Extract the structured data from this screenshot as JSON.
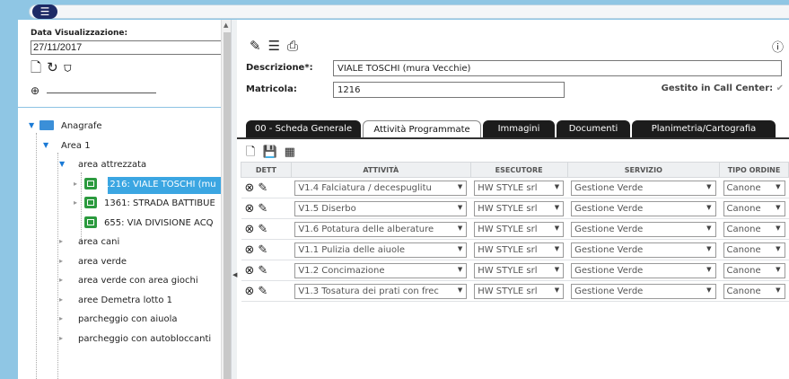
{
  "header": {
    "menu_icon": "hamburger-icon"
  },
  "filters": {
    "date_label": "Data Visualizzazione:",
    "date_value": "27/11/2017"
  },
  "tree": [
    {
      "label": "Anagrafe"
    },
    {
      "label": "Area 1"
    },
    {
      "label": "area attrezzata"
    },
    {
      "label": "1216: VIALE TOSCHI (mu"
    },
    {
      "label": "1361: STRADA BATTIBUE"
    },
    {
      "label": "655: VIA DIVISIONE ACQ"
    },
    {
      "label": "area cani"
    },
    {
      "label": "area verde"
    },
    {
      "label": "area verde con area giochi"
    },
    {
      "label": "aree Demetra lotto 1"
    },
    {
      "label": "parcheggio con aiuola"
    },
    {
      "label": "parcheggio con autobloccanti"
    }
  ],
  "detail": {
    "descrizione_label": "Descrizione*:",
    "descrizione_value": "VIALE TOSCHI (mura Vecchie)",
    "matricola_label": "Matricola:",
    "matricola_value": "1216",
    "callcenter_label": "Gestito in Call Center:",
    "callcenter_mark": "✔"
  },
  "tabs": [
    "00 - Scheda Generale",
    "Attività Programmate",
    "Immagini",
    "Documenti",
    "Planimetria/Cartografia"
  ],
  "grid": {
    "headers": [
      "DETT",
      "ATTIVITÀ",
      "ESECUTORE",
      "SERVIZIO",
      "TIPO ORDINE"
    ],
    "rows": [
      {
        "attivita": "V1.4 Falciatura / decespuglitu",
        "esecutore": "HW STYLE srl",
        "servizio": "Gestione Verde",
        "tipo": "Canone"
      },
      {
        "attivita": "V1.5 Diserbo",
        "esecutore": "HW STYLE srl",
        "servizio": "Gestione Verde",
        "tipo": "Canone"
      },
      {
        "attivita": "V1.6 Potatura delle alberature",
        "esecutore": "HW STYLE srl",
        "servizio": "Gestione Verde",
        "tipo": "Canone"
      },
      {
        "attivita": "V1.1 Pulizia delle aiuole",
        "esecutore": "HW STYLE srl",
        "servizio": "Gestione Verde",
        "tipo": "Canone"
      },
      {
        "attivita": "V1.2 Concimazione",
        "esecutore": "HW STYLE srl",
        "servizio": "Gestione Verde",
        "tipo": "Canone"
      },
      {
        "attivita": "V1.3 Tosatura dei prati con frec",
        "esecutore": "HW STYLE srl",
        "servizio": "Gestione Verde",
        "tipo": "Canone"
      }
    ]
  }
}
